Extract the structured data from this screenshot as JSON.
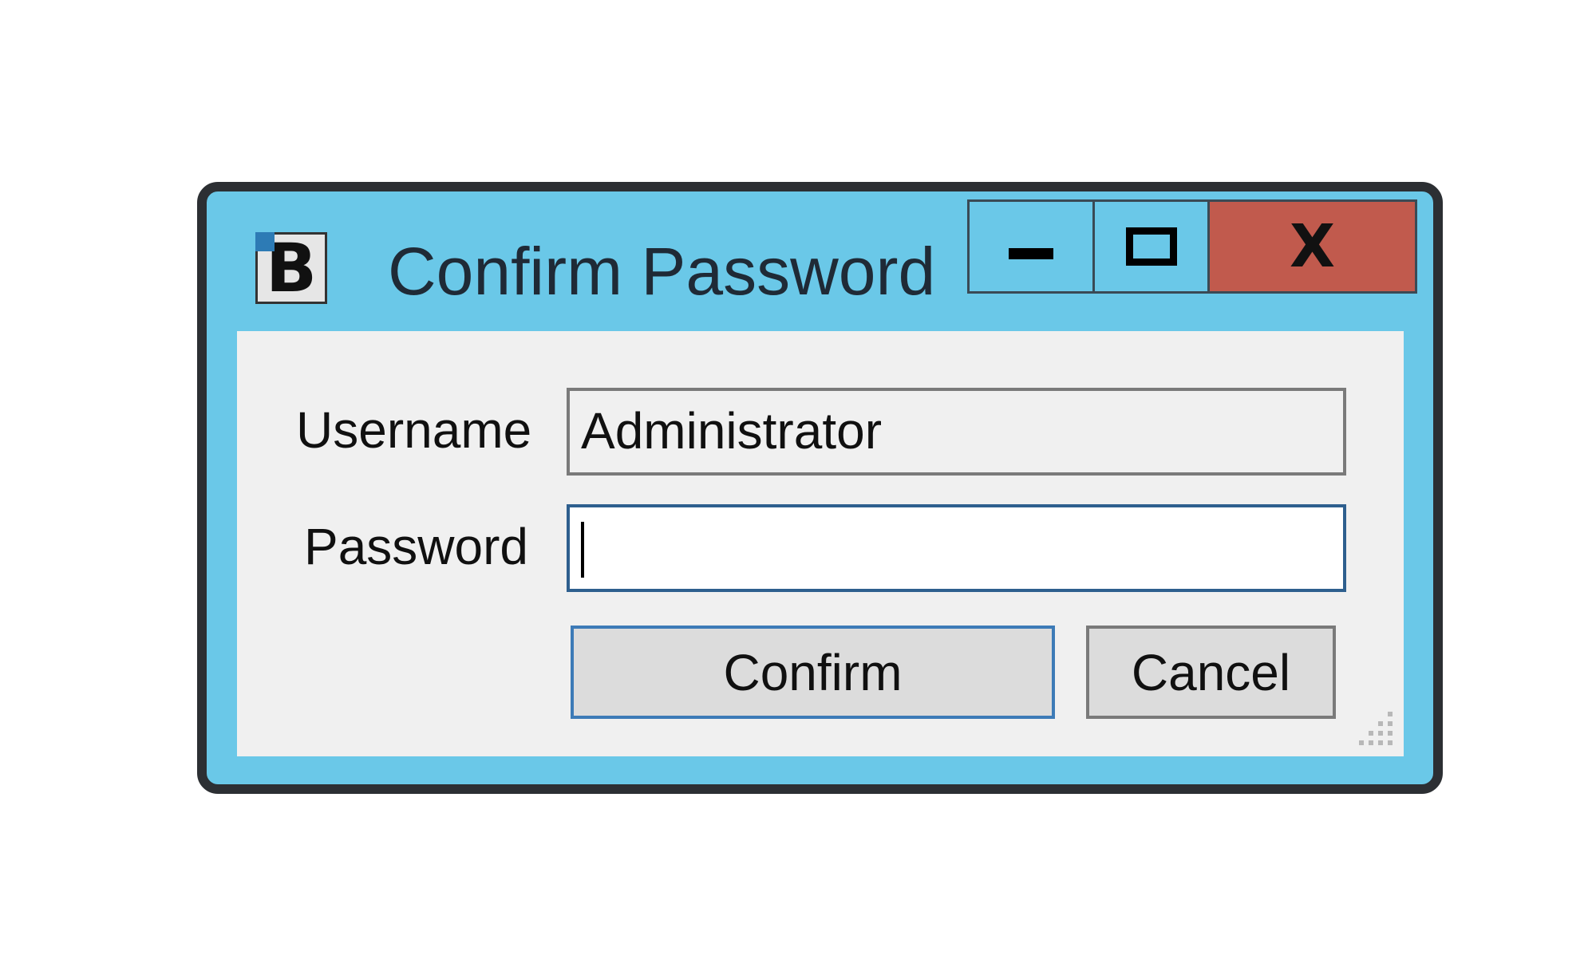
{
  "window": {
    "title": "Confirm Password",
    "app_icon_letter": "B",
    "caption": {
      "minimize_icon": "minimize-icon",
      "maximize_icon": "maximize-icon",
      "close_icon": "close-icon",
      "close_glyph": "X"
    }
  },
  "form": {
    "username_label": "Username",
    "username_value": "Administrator",
    "password_label": "Password",
    "password_value": ""
  },
  "buttons": {
    "confirm_label": "Confirm",
    "cancel_label": "Cancel"
  },
  "colors": {
    "frame": "#6ac8e8",
    "close_button": "#c15a4d",
    "focus_border": "#2e5f8e",
    "client_bg": "#f0f0f0"
  }
}
